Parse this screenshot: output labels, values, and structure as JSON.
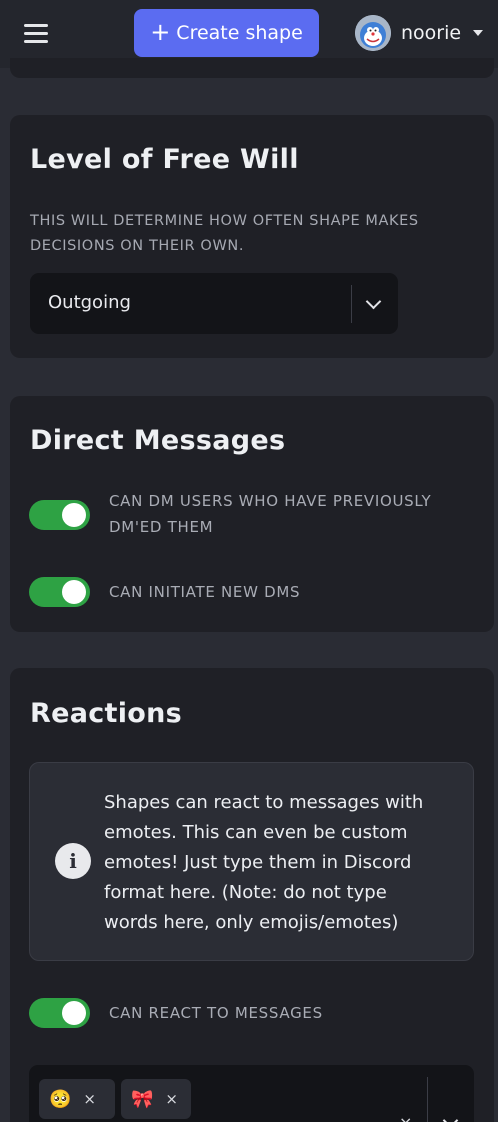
{
  "header": {
    "create_label": "Create shape",
    "plus": "+",
    "username": "noorie"
  },
  "free_will": {
    "title": "Level of Free Will",
    "caption_line1": "THIS WILL DETERMINE HOW OFTEN SHAPE MAKES",
    "caption_line2": "DECISIONS ON THEIR OWN.",
    "selected": "Outgoing"
  },
  "direct_messages": {
    "title": "Direct Messages",
    "toggles": [
      {
        "line1": "CAN DM USERS WHO HAVE PREVIOUSLY",
        "line2": "DM'ED THEM",
        "on": true
      },
      {
        "line1": "CAN INITIATE NEW DMS",
        "line2": "",
        "on": true
      }
    ]
  },
  "reactions": {
    "title": "Reactions",
    "info_lines": [
      "Shapes can react to messages with",
      "emotes. This can even be custom",
      "emotes! Just type them in Discord",
      "format here. (Note: do not type",
      "words here, only emojis/emotes)"
    ],
    "info_icon": "i",
    "toggle_label": "CAN REACT TO MESSAGES",
    "toggle_on": true,
    "chips": [
      {
        "emoji": "🥺",
        "remove": "×"
      },
      {
        "emoji": "🎀",
        "remove": "×"
      }
    ],
    "clear": "×"
  },
  "colors": {
    "accent": "#5b6cf1",
    "toggle_on": "#2ea244",
    "card_bg": "#1f2026",
    "page_bg": "#2a2c34"
  },
  "icons": [
    "menu-icon",
    "plus-icon",
    "avatar",
    "caret-down-icon",
    "chevron-down-icon",
    "info-icon",
    "close-icon"
  ]
}
